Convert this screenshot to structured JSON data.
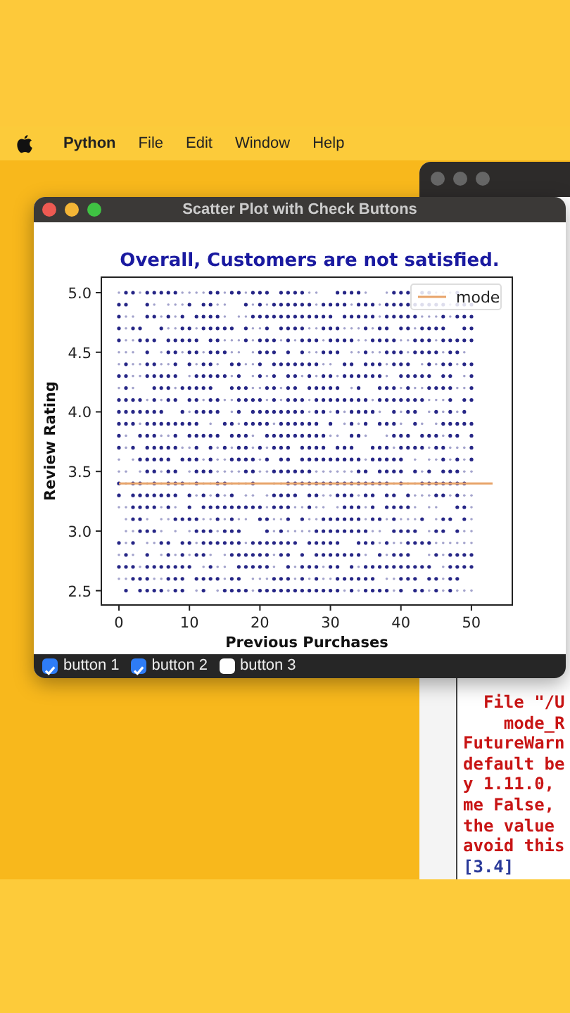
{
  "menu_bar": {
    "app_name": "Python",
    "menus": [
      "File",
      "Edit",
      "Window",
      "Help"
    ]
  },
  "plot_window": {
    "title": "Scatter Plot with Check Buttons",
    "chart_data": {
      "type": "scatter",
      "title": "Overall, Customers are not satisfied.",
      "xlabel": "Previous Purchases",
      "ylabel": "Review Rating",
      "xlim": [
        -2.5,
        55.8
      ],
      "ylim": [
        2.38,
        5.13
      ],
      "xticks": [
        0,
        10,
        20,
        30,
        40,
        50
      ],
      "yticks": [
        {
          "value": 2.5,
          "label": "2.5"
        },
        {
          "value": 3,
          "label": "3.0"
        },
        {
          "value": 3.5,
          "label": "3.5"
        },
        {
          "value": 4,
          "label": "4.0"
        },
        {
          "value": 4.5,
          "label": "4.5"
        },
        {
          "value": 5,
          "label": "5.0"
        }
      ],
      "series": [
        {
          "name": "mode",
          "type": "line",
          "color": "#e8a46a",
          "x": [
            0,
            53
          ],
          "values": [
            3.4,
            3.4
          ]
        }
      ]
    },
    "check_buttons": [
      {
        "label": "button 1",
        "checked": true
      },
      {
        "label": "button 2",
        "checked": true
      },
      {
        "label": "button 3",
        "checked": false
      }
    ]
  },
  "terminal": {
    "lines": [
      {
        "text": "  File \"/U",
        "kind": "error"
      },
      {
        "text": "    mode_R",
        "kind": "error"
      },
      {
        "text": "FutureWarn",
        "kind": "error"
      },
      {
        "text": "default be",
        "kind": "error"
      },
      {
        "text": "y 1.11.0,",
        "kind": "error"
      },
      {
        "text": "me False,",
        "kind": "error"
      },
      {
        "text": "the value",
        "kind": "error"
      },
      {
        "text": "avoid this",
        "kind": "error"
      },
      {
        "text": "[3.4]",
        "kind": "output"
      }
    ]
  }
}
